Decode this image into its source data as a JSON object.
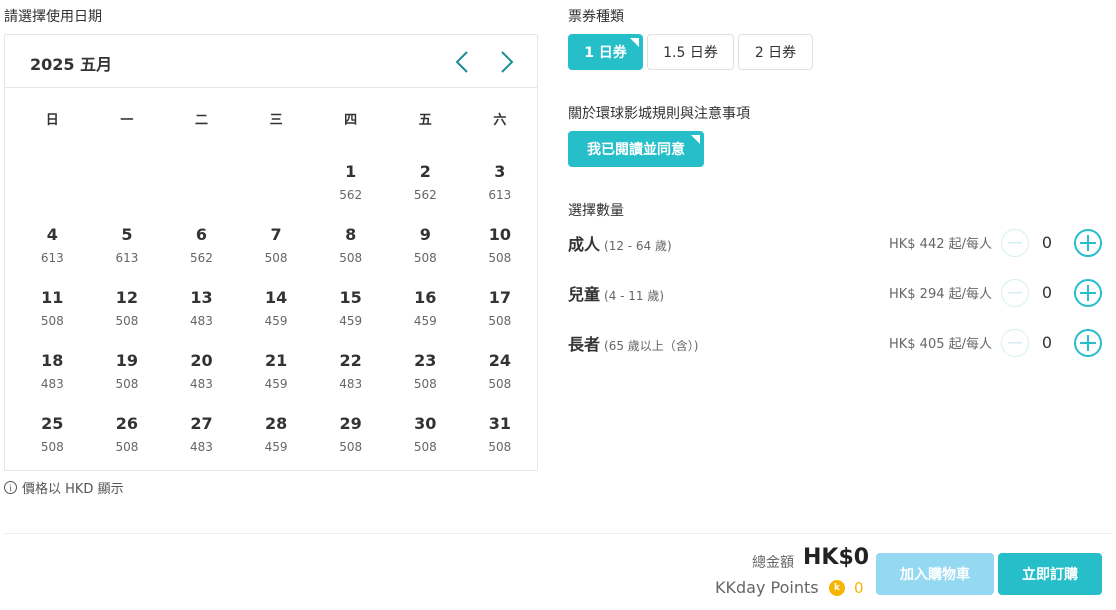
{
  "date_section": {
    "label": "請選擇使用日期",
    "calendar_title": "2025 五月",
    "weekdays": [
      "日",
      "一",
      "二",
      "三",
      "四",
      "五",
      "六"
    ],
    "days": [
      {
        "num": "",
        "price": ""
      },
      {
        "num": "",
        "price": ""
      },
      {
        "num": "",
        "price": ""
      },
      {
        "num": "",
        "price": ""
      },
      {
        "num": "1",
        "price": "562"
      },
      {
        "num": "2",
        "price": "562"
      },
      {
        "num": "3",
        "price": "613"
      },
      {
        "num": "4",
        "price": "613"
      },
      {
        "num": "5",
        "price": "613"
      },
      {
        "num": "6",
        "price": "562"
      },
      {
        "num": "7",
        "price": "508"
      },
      {
        "num": "8",
        "price": "508"
      },
      {
        "num": "9",
        "price": "508"
      },
      {
        "num": "10",
        "price": "508"
      },
      {
        "num": "11",
        "price": "508"
      },
      {
        "num": "12",
        "price": "508"
      },
      {
        "num": "13",
        "price": "483"
      },
      {
        "num": "14",
        "price": "459"
      },
      {
        "num": "15",
        "price": "459"
      },
      {
        "num": "16",
        "price": "459"
      },
      {
        "num": "17",
        "price": "508"
      },
      {
        "num": "18",
        "price": "483"
      },
      {
        "num": "19",
        "price": "508"
      },
      {
        "num": "20",
        "price": "483"
      },
      {
        "num": "21",
        "price": "459"
      },
      {
        "num": "22",
        "price": "483"
      },
      {
        "num": "23",
        "price": "508"
      },
      {
        "num": "24",
        "price": "508"
      },
      {
        "num": "25",
        "price": "508"
      },
      {
        "num": "26",
        "price": "508"
      },
      {
        "num": "27",
        "price": "483"
      },
      {
        "num": "28",
        "price": "459"
      },
      {
        "num": "29",
        "price": "508"
      },
      {
        "num": "30",
        "price": "508"
      },
      {
        "num": "31",
        "price": "508"
      }
    ],
    "note": "價格以 HKD 顯示",
    "note_icon": "i"
  },
  "ticket_section": {
    "label": "票券種類",
    "options": [
      "1 日券",
      "1.5 日券",
      "2 日券"
    ],
    "selected": "1 日券"
  },
  "rules_section": {
    "label": "關於環球影城規則與注意事項",
    "agree_label": "我已閱讀並同意"
  },
  "quantity_section": {
    "label": "選擇數量",
    "rows": [
      {
        "name": "成人",
        "sub": "(12 - 64 歲)",
        "price": "HK$ 442 起/每人",
        "qty": "0"
      },
      {
        "name": "兒童",
        "sub": "(4 - 11 歲)",
        "price": "HK$ 294 起/每人",
        "qty": "0"
      },
      {
        "name": "長者",
        "sub": "(65 歲以上（含）)",
        "price": "HK$ 405 起/每人",
        "qty": "0"
      }
    ]
  },
  "footer": {
    "total_label": "總金額",
    "total_value": "HK$0",
    "points_label": "KKday Points",
    "points_coin": "k",
    "points_value": "0",
    "add_cart_label": "加入購物車",
    "book_now_label": "立即訂購"
  },
  "colors": {
    "accent": "#26bec9",
    "accent_light": "#94d8f2",
    "coin": "#f7b500"
  }
}
